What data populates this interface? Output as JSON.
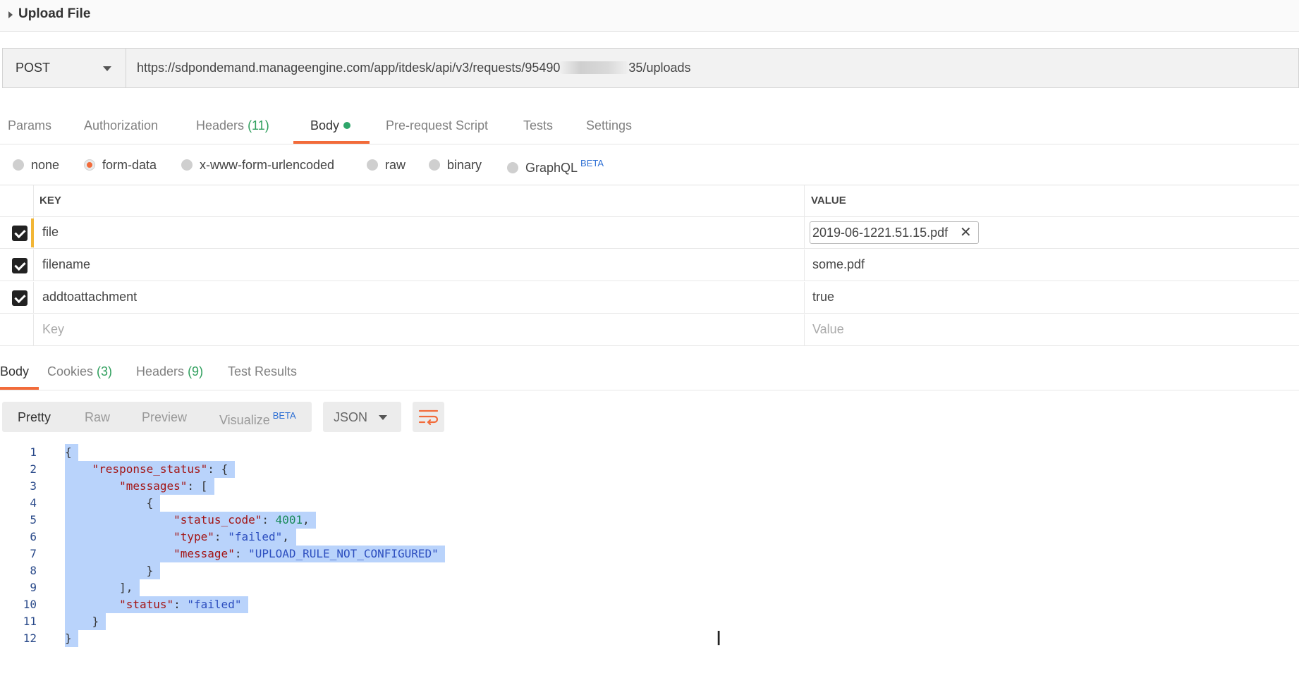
{
  "header": {
    "title": "Upload File"
  },
  "request": {
    "method": "POST",
    "url_prefix": "https://sdpondemand.manageengine.com/app/itdesk/api/v3/requests/95490",
    "url_suffix": "35/uploads"
  },
  "request_tabs": [
    {
      "label": "Params"
    },
    {
      "label": "Authorization"
    },
    {
      "label": "Headers",
      "count": "(11)"
    },
    {
      "label": "Body",
      "active": true
    },
    {
      "label": "Pre-request Script"
    },
    {
      "label": "Tests"
    },
    {
      "label": "Settings"
    }
  ],
  "body_types": {
    "none": "none",
    "form_data": "form-data",
    "urlencoded": "x-www-form-urlencoded",
    "raw": "raw",
    "binary": "binary",
    "graphql": "GraphQL",
    "graphql_badge": "BETA",
    "selected": "form-data"
  },
  "params_table": {
    "key_header": "KEY",
    "value_header": "VALUE",
    "rows": [
      {
        "checked": true,
        "key": "file",
        "value": "2019-06-1221.51.15.pdf"
      },
      {
        "checked": true,
        "key": "filename",
        "value": "some.pdf"
      },
      {
        "checked": true,
        "key": "addtoattachment",
        "value": "true"
      }
    ],
    "key_placeholder": "Key",
    "value_placeholder": "Value"
  },
  "response_tabs": {
    "body": "Body",
    "cookies": "Cookies",
    "cookies_count": "(3)",
    "headers": "Headers",
    "headers_count": "(9)",
    "test_results": "Test Results"
  },
  "format_bar": {
    "pretty": "Pretty",
    "raw": "Raw",
    "preview": "Preview",
    "visualize": "Visualize",
    "visualize_badge": "BETA",
    "language": "JSON"
  },
  "response_body": {
    "line_numbers": [
      "1",
      "2",
      "3",
      "4",
      "5",
      "6",
      "7",
      "8",
      "9",
      "10",
      "11",
      "12"
    ],
    "key_response_status": "\"response_status\"",
    "key_messages": "\"messages\"",
    "key_status_code": "\"status_code\"",
    "val_status_code": "4001",
    "key_type": "\"type\"",
    "val_type": "\"failed\"",
    "key_message": "\"message\"",
    "val_message": "\"UPLOAD_RULE_NOT_CONFIGURED\"",
    "key_status": "\"status\"",
    "val_status": "\"failed\""
  },
  "colors": {
    "accent": "#f26b3a",
    "count_green": "#2f9f5d",
    "selection": "#b9d3fb",
    "beta_blue": "#2d6fd4"
  }
}
